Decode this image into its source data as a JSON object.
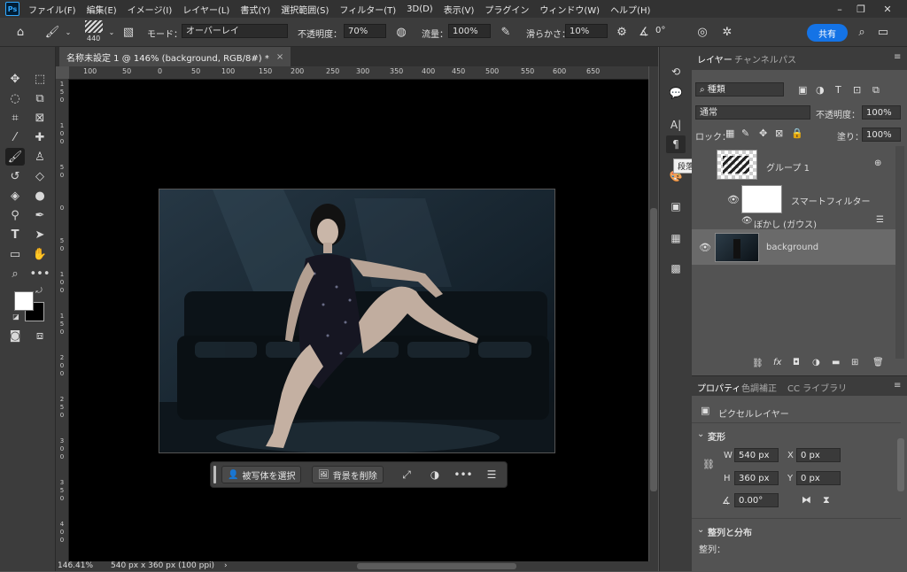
{
  "menubar": {
    "items": [
      "ファイル(F)",
      "編集(E)",
      "イメージ(I)",
      "レイヤー(L)",
      "書式(Y)",
      "選択範囲(S)",
      "フィルター(T)",
      "3D(D)",
      "表示(V)",
      "プラグイン",
      "ウィンドウ(W)",
      "ヘルプ(H)"
    ],
    "logo": "Ps"
  },
  "options": {
    "brush_size": "440",
    "mode_label": "モード：",
    "mode_value": "オーバーレイ",
    "opacity_label": "不透明度：",
    "opacity_value": "70%",
    "flow_label": "流量：",
    "flow_value": "100%",
    "smoothing_label": "滑らかさ：",
    "smoothing_value": "10%",
    "angle_value": "0°",
    "share_label": "共有"
  },
  "document": {
    "tab_title": "名称未設定 1 @ 146% (background, RGB/8#) *",
    "zoom": "146.41%",
    "doc_info": "540 px x 360 px (100 ppi)",
    "ruler_top": [
      "100",
      "50",
      "0",
      "50",
      "100",
      "150",
      "200",
      "250",
      "300",
      "350",
      "400",
      "450",
      "500",
      "550",
      "600",
      "650"
    ],
    "ruler_left": [
      "1",
      "5",
      "0",
      "1",
      "0",
      "0",
      "5",
      "0",
      "0",
      "5",
      "0",
      "1",
      "0",
      "0",
      "1",
      "5",
      "0",
      "2",
      "0",
      "0",
      "2",
      "5",
      "0",
      "3",
      "0",
      "0",
      "3",
      "5",
      "0",
      "4",
      "0",
      "0",
      "4",
      "5",
      "0"
    ]
  },
  "context_bar": {
    "select_subject": "被写体を選択",
    "remove_background": "背景を削除"
  },
  "tooltip": "段落",
  "layers": {
    "tabs": [
      "レイヤー",
      "チャンネル",
      "パス"
    ],
    "filter_label": "種類",
    "blend_mode": "通常",
    "opacity_label": "不透明度：",
    "opacity_value": "100%",
    "lock_label": "ロック：",
    "fill_label": "塗り：",
    "fill_value": "100%",
    "items": [
      {
        "name": "グループ 1"
      },
      {
        "name": "スマートフィルター"
      },
      {
        "name": "ぼかし (ガウス)"
      },
      {
        "name": "background"
      }
    ]
  },
  "properties": {
    "tabs": [
      "プロパティ",
      "色調補正",
      "CC ライブラリ"
    ],
    "layer_type": "ピクセルレイヤー",
    "transform_heading": "変形",
    "w_label": "W",
    "w_value": "540 px",
    "h_label": "H",
    "h_value": "360 px",
    "x_label": "X",
    "x_value": "0 px",
    "y_label": "Y",
    "y_value": "0 px",
    "angle_value": "0.00°",
    "align_heading": "整列と分布",
    "align_label": "整列："
  },
  "colors": {
    "accent": "#1473e6",
    "panel_bg": "#535353",
    "dark_bg": "#3c3c3c"
  }
}
